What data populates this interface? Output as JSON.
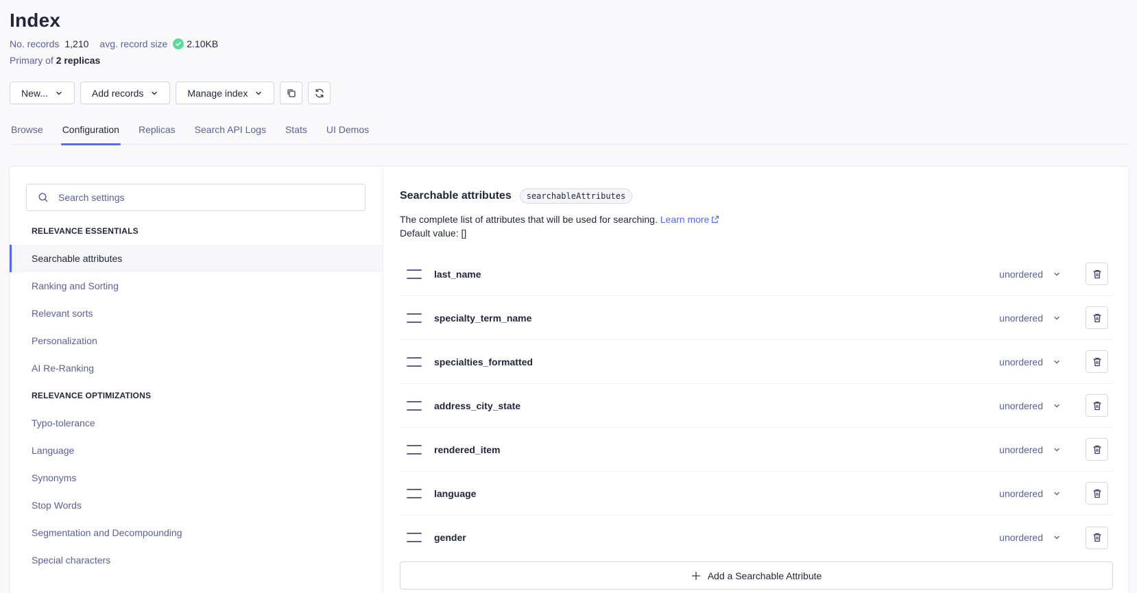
{
  "header": {
    "title": "Index",
    "records_label": "No. records",
    "records_value": "1,210",
    "avg_label": "avg. record size",
    "avg_value": "2.10KB",
    "replica_prefix": "Primary of",
    "replica_value": "2 replicas"
  },
  "toolbar": {
    "new_label": "New...",
    "add_records_label": "Add records",
    "manage_index_label": "Manage index",
    "copy_icon": "copy-icon",
    "refresh_icon": "refresh-icon"
  },
  "tabs": [
    {
      "label": "Browse"
    },
    {
      "label": "Configuration",
      "active": true
    },
    {
      "label": "Replicas"
    },
    {
      "label": "Search API Logs"
    },
    {
      "label": "Stats"
    },
    {
      "label": "UI Demos"
    }
  ],
  "sidebar": {
    "search_placeholder": "Search settings",
    "sections": [
      {
        "title": "RELEVANCE ESSENTIALS"
      },
      {
        "title": "RELEVANCE OPTIMIZATIONS"
      }
    ],
    "items": [
      {
        "label": "Searchable attributes",
        "active": true
      },
      {
        "label": "Ranking and Sorting"
      },
      {
        "label": "Relevant sorts"
      },
      {
        "label": "Personalization"
      },
      {
        "label": "AI Re-Ranking"
      },
      {
        "label": "Typo-tolerance"
      },
      {
        "label": "Language"
      },
      {
        "label": "Synonyms"
      },
      {
        "label": "Stop Words"
      },
      {
        "label": "Segmentation and Decompounding"
      },
      {
        "label": "Special characters"
      }
    ]
  },
  "main": {
    "title": "Searchable attributes",
    "badge": "searchableAttributes",
    "description": "The complete list of attributes that will be used for searching.",
    "learn_more": "Learn more",
    "default_value": "Default value: []",
    "attributes": [
      {
        "name": "last_name",
        "order": "unordered"
      },
      {
        "name": "specialty_term_name",
        "order": "unordered"
      },
      {
        "name": "specialties_formatted",
        "order": "unordered"
      },
      {
        "name": "address_city_state",
        "order": "unordered"
      },
      {
        "name": "rendered_item",
        "order": "unordered"
      },
      {
        "name": "language",
        "order": "unordered"
      },
      {
        "name": "gender",
        "order": "unordered"
      }
    ],
    "add_label": "Add a Searchable Attribute"
  },
  "colors": {
    "accent": "#5468ff",
    "success": "#5adc9a",
    "text": "#23263b",
    "muted": "#5a5e9a"
  }
}
